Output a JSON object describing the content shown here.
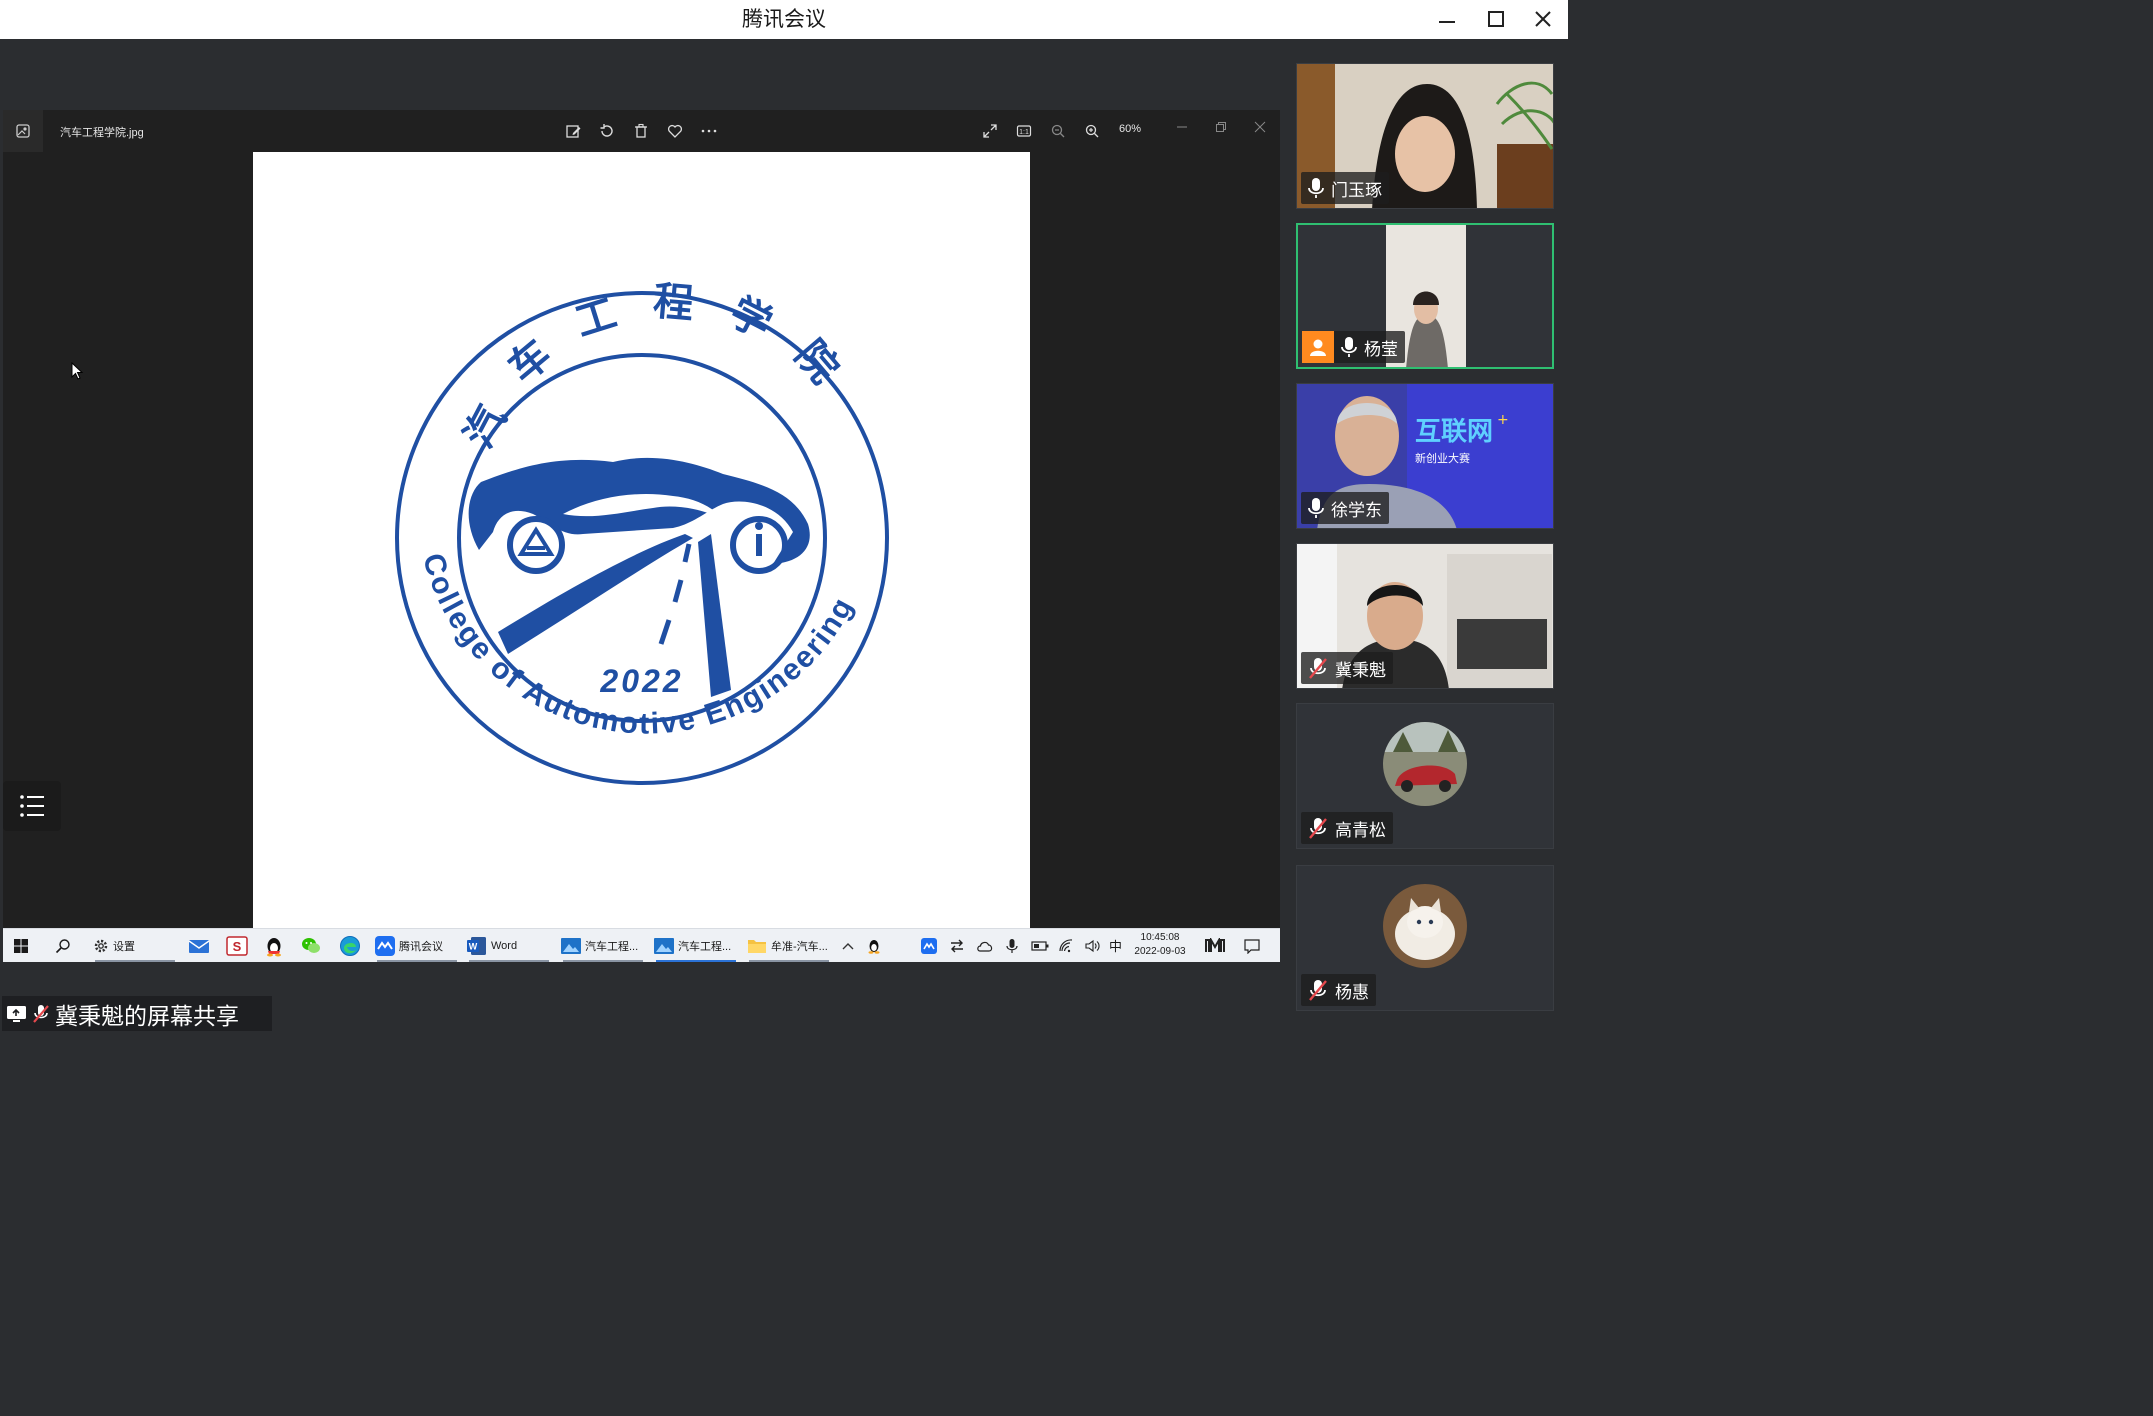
{
  "window": {
    "title": "腾讯会议"
  },
  "photos": {
    "filename": "汽车工程学院.jpg",
    "zoom": "60%"
  },
  "logo": {
    "chinese_name": "汽车工程学院",
    "english_name": "College of Automotive Engineering",
    "year": "2022",
    "brand_color": "#1f4fa3"
  },
  "taskbar": {
    "settings_label": "设置",
    "tencent_label": "腾讯会议",
    "word_label": "Word",
    "photos1_label": "汽车工程...",
    "photos2_label": "汽车工程...",
    "explorer_label": "牟准-汽车...",
    "ime_label": "中",
    "time": "10:45:08",
    "date": "2022-09-03"
  },
  "share_footer": {
    "label": "冀秉魁的屏幕共享"
  },
  "participants": [
    {
      "name": "门玉琢",
      "mic": "on",
      "host": false
    },
    {
      "name": "杨莹",
      "mic": "on",
      "host": true
    },
    {
      "name": "徐学东",
      "mic": "on",
      "host": false
    },
    {
      "name": "冀秉魁",
      "mic": "muted",
      "host": false
    },
    {
      "name": "高青松",
      "mic": "muted",
      "host": false
    },
    {
      "name": "杨惠",
      "mic": "muted",
      "host": false
    }
  ],
  "colors": {
    "panel_bg": "#2b2d30",
    "active_speaker": "#2fbf71",
    "host_badge": "#ff8a1f",
    "mute_red": "#e5484d"
  }
}
